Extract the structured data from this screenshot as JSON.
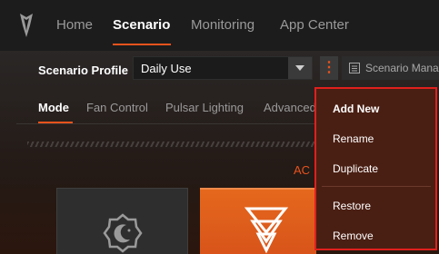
{
  "nav": {
    "items": [
      {
        "label": "Home"
      },
      {
        "label": "Scenario"
      },
      {
        "label": "Monitoring"
      },
      {
        "label": "App Center"
      }
    ],
    "active": "Scenario"
  },
  "profile": {
    "label": "Scenario Profile",
    "value": "Daily Use",
    "more_icon": "kebab-icon",
    "manage_label": "Scenario Manag"
  },
  "tabs": {
    "items": [
      {
        "label": "Mode"
      },
      {
        "label": "Fan Control"
      },
      {
        "label": "Pulsar Lighting"
      },
      {
        "label": "Advanced"
      }
    ],
    "active": "Mode"
  },
  "mode": {
    "active_text": "AC"
  },
  "menu": {
    "items": [
      {
        "label": "Add New"
      },
      {
        "label": "Rename"
      },
      {
        "label": "Duplicate"
      },
      {
        "label": "Restore"
      },
      {
        "label": "Remove"
      }
    ],
    "highlight_color": "#e0201d"
  },
  "colors": {
    "accent": "#e8531d",
    "background": "#171717",
    "menu_bg": "#4a1f13"
  }
}
